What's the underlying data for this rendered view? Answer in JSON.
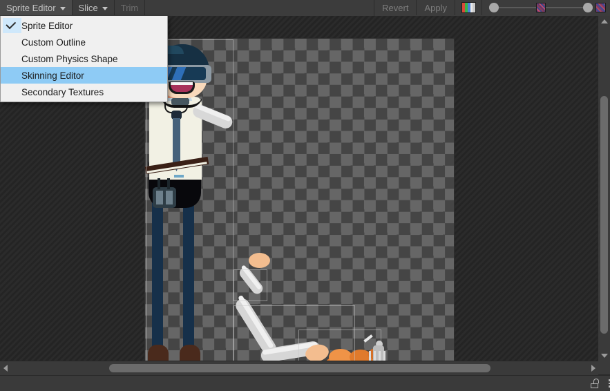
{
  "window": {
    "title": "Sprite Editor"
  },
  "toolbar": {
    "mode_button": {
      "label": "Sprite Editor",
      "icon": "chevron-down-icon",
      "expanded": true
    },
    "slice_button": {
      "label": "Slice",
      "icon": "chevron-down-icon"
    },
    "trim_button": {
      "label": "Trim",
      "enabled": false
    },
    "revert_button": {
      "label": "Revert",
      "enabled": false
    },
    "apply_button": {
      "label": "Apply",
      "enabled": false
    },
    "rgb_toggle": {
      "icon": "rgb-channels-icon"
    },
    "sliders": [
      {
        "name": "alpha-slider",
        "value": 0,
        "position_pct": 0
      },
      {
        "name": "pixelation-slider",
        "value": 100,
        "position_pct": 100
      }
    ]
  },
  "menu": {
    "open": true,
    "items": [
      {
        "label": "Sprite Editor",
        "checked": true,
        "selected": false
      },
      {
        "label": "Custom Outline",
        "checked": false,
        "selected": false
      },
      {
        "label": "Custom Physics Shape",
        "checked": false,
        "selected": false
      },
      {
        "label": "Skinning Editor",
        "checked": false,
        "selected": true
      },
      {
        "label": "Secondary Textures",
        "checked": false,
        "selected": false
      }
    ]
  },
  "canvas": {
    "background": "checkerboard",
    "checker_colors": [
      "#666666",
      "#454545"
    ],
    "sprites": [
      {
        "name": "character-businessman-vr",
        "slice_rect": true
      },
      {
        "name": "arm-upper-sprite",
        "slice_rect": true
      },
      {
        "name": "arm-lower-sprite",
        "slice_rect": true
      },
      {
        "name": "roast-turkey-sprite",
        "slice_rect": true
      }
    ]
  },
  "scrollbars": {
    "vertical": {
      "thumb_top_pct": 23,
      "thumb_size_pct": 69
    },
    "horizontal": {
      "thumb_left_pct": 18,
      "thumb_size_pct": 64
    }
  },
  "statusbar": {
    "lock_icon": "unlocked-padlock-icon",
    "menu_icon": "kebab-menu-icon"
  },
  "colors": {
    "accent_selection": "#8ecbf5",
    "toolbar_bg": "#3c3c3c",
    "panel_bg": "#282828",
    "menu_bg": "#f0f0f0"
  }
}
